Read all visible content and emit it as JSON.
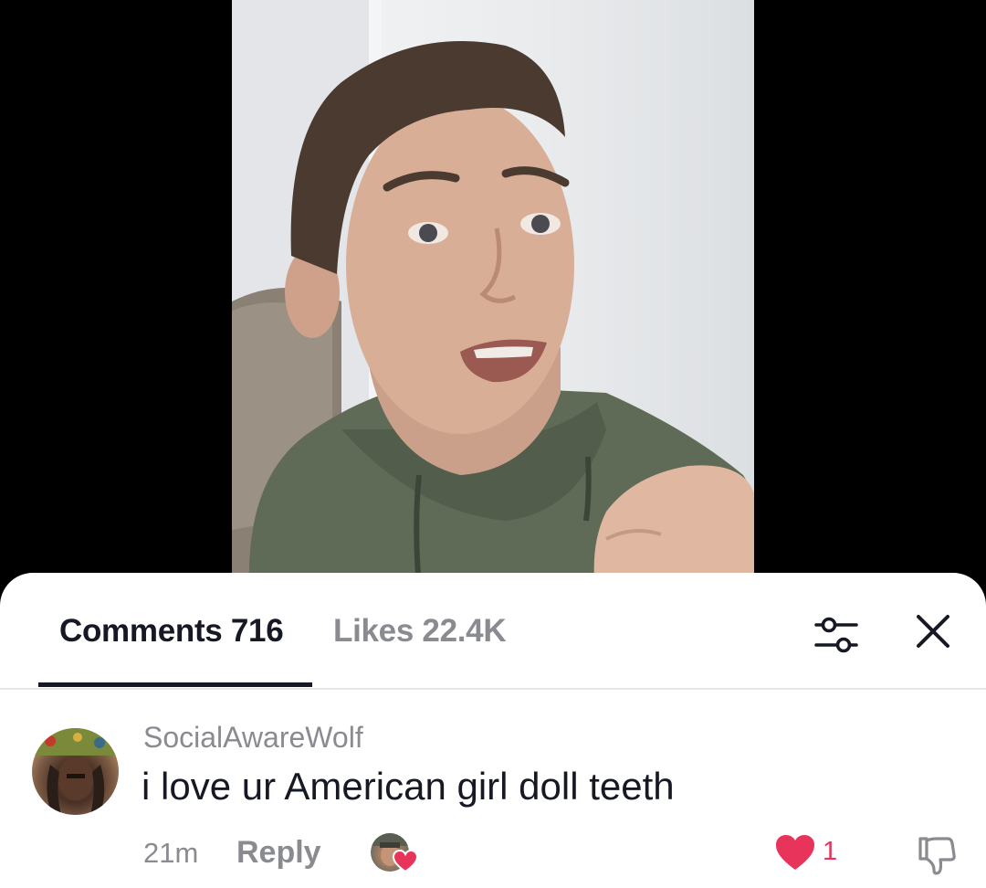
{
  "tabs": [
    {
      "label": "Comments 716",
      "active": true
    },
    {
      "label": "Likes 22.4K",
      "active": false
    }
  ],
  "colors": {
    "text_primary": "#161823",
    "text_secondary": "#8a8b91",
    "like_red": "#e8345a",
    "divider": "#e6e6e6"
  },
  "icons": {
    "filter": "sliders-icon",
    "close": "close-icon",
    "like": "heart-icon",
    "dislike": "thumbs-down-icon"
  },
  "comment": {
    "username": "SocialAwareWolf",
    "text": "i love ur American girl doll teeth",
    "time": "21m",
    "reply_label": "Reply",
    "like_count": "1",
    "liked": true,
    "liked_by_creator": true
  }
}
